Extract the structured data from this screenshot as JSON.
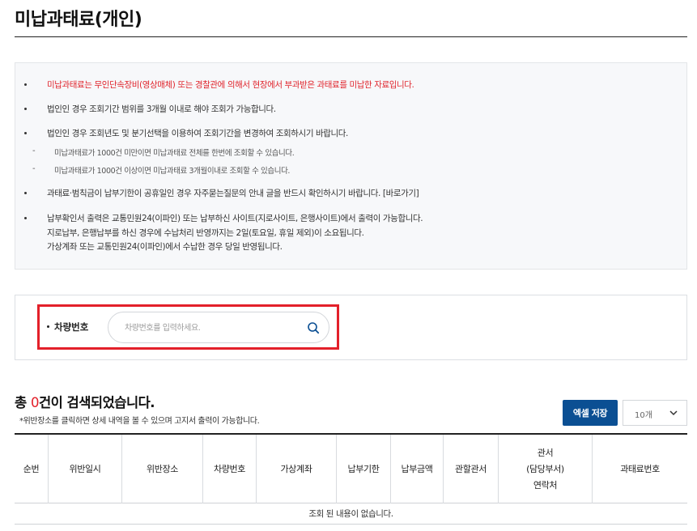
{
  "page": {
    "title": "미납과태료(개인)"
  },
  "notices": {
    "items": [
      "미납과태료는 무인단속장비(영상매체) 또는 경찰관에 의해서 현장에서 부과받은 과태료를 미납한 자료입니다.",
      "법인인 경우 조회기간 범위를 3개월 이내로 해야 조회가 가능합니다.",
      "법인인 경우 조회년도 및 분기선택을 이용하여 조회기간을 변경하여 조회하시기 바랍니다.",
      "과태료·범칙금이 납부기한이 공휴일인 경우 자주묻는질문의 안내 글을 반드시 확인하시기 바랍니다. [바로가기]",
      "납부확인서 출력은 교통민원24(이파인) 또는 납부하신 사이트(지로사이트, 은행사이트)에서 출력이 가능합니다."
    ],
    "sub_items": [
      "미납과태료가 1000건 미만이면 미납과태료 전체를 한번에 조회할 수 있습니다.",
      "미납과태료가 1000건 이상이면 미납과태료 3개월이내로 조회할 수 있습니다."
    ],
    "continuation": [
      "지로납부, 은행납부를 하신 경우에 수납처리 반영까지는 2일(토요일, 휴일 제외)이 소요됩니다.",
      "가상계좌 또는 교통민원24(이파인)에서 수납한 경우 당일 반영됩니다."
    ],
    "highlight_color": "#e0242c"
  },
  "search": {
    "label": "차량번호",
    "placeholder": "차량번호를 입력하세요.",
    "value": "",
    "icon": "search-icon",
    "highlight_color": "#e3202a"
  },
  "results": {
    "prefix": "총 ",
    "count": "0",
    "suffix": "건이 검색되었습니다.",
    "note": "*위반장소를 클릭하면 상세 내역을 볼 수 있으며 고지서 출력이 가능합니다.",
    "excel_button": "엑셀 저장",
    "page_size": "10개",
    "accent_color": "#0b4f93"
  },
  "table": {
    "headers": [
      "순번",
      "위반일시",
      "위반장소",
      "차량번호",
      "가상계좌",
      "납부기한",
      "납부금액",
      "관할관서",
      "관서\n(담당부서)\n연락처",
      "과태료번호"
    ],
    "empty_message": "조회 된 내용이 없습니다."
  }
}
